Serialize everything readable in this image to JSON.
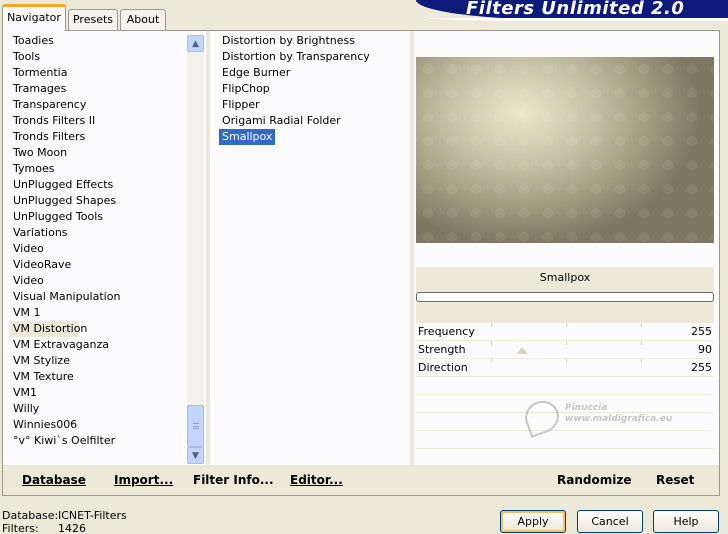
{
  "tabs": [
    {
      "label": "Navigator",
      "active": true
    },
    {
      "label": "Presets",
      "active": false
    },
    {
      "label": "About",
      "active": false
    }
  ],
  "banner": {
    "title": "Filters Unlimited 2.0"
  },
  "categories": [
    "Toadies",
    "Tools",
    "Tormentia",
    "Tramages",
    "Transparency",
    "Tronds Filters II",
    "Tronds Filters",
    "Two Moon",
    "Tymoes",
    "UnPlugged Effects",
    "UnPlugged Shapes",
    "UnPlugged Tools",
    "Variations",
    "Video",
    "VideoRave",
    "Video",
    "Visual Manipulation",
    "VM 1",
    "VM Distortion",
    "VM Extravaganza",
    "VM Stylize",
    "VM Texture",
    "VM1",
    "Willy",
    "Winnies006",
    "°v° Kiwi`s Oelfilter"
  ],
  "selected_category": "VM Distortion",
  "filters": [
    "Distortion by Brightness",
    "Distortion by Transparency",
    "Edge Burner",
    "FlipChop",
    "Flipper",
    "Origami Radial Folder",
    "Smallpox"
  ],
  "selected_filter": "Smallpox",
  "preview": {
    "filter_name": "Smallpox"
  },
  "params": [
    {
      "name": "Frequency",
      "value": "255"
    },
    {
      "name": "Strength",
      "value": "90"
    },
    {
      "name": "Direction",
      "value": "255"
    }
  ],
  "actions": {
    "database": "Database",
    "import": "Import...",
    "filter_info": "Filter Info...",
    "editor": "Editor...",
    "randomize": "Randomize",
    "reset": "Reset"
  },
  "status": {
    "database_label": "Database:",
    "database_value": "ICNET-Filters",
    "filters_label": "Filters:",
    "filters_value": "1426"
  },
  "buttons": {
    "apply": "Apply",
    "cancel": "Cancel",
    "help": "Help"
  },
  "watermark": {
    "line1": "Pinuccia",
    "line2": "www.maldigrafica.eu"
  },
  "colors": {
    "selection": "#316ac5",
    "banner": "#0d1a7a",
    "tab_accent": "#f5a623"
  }
}
